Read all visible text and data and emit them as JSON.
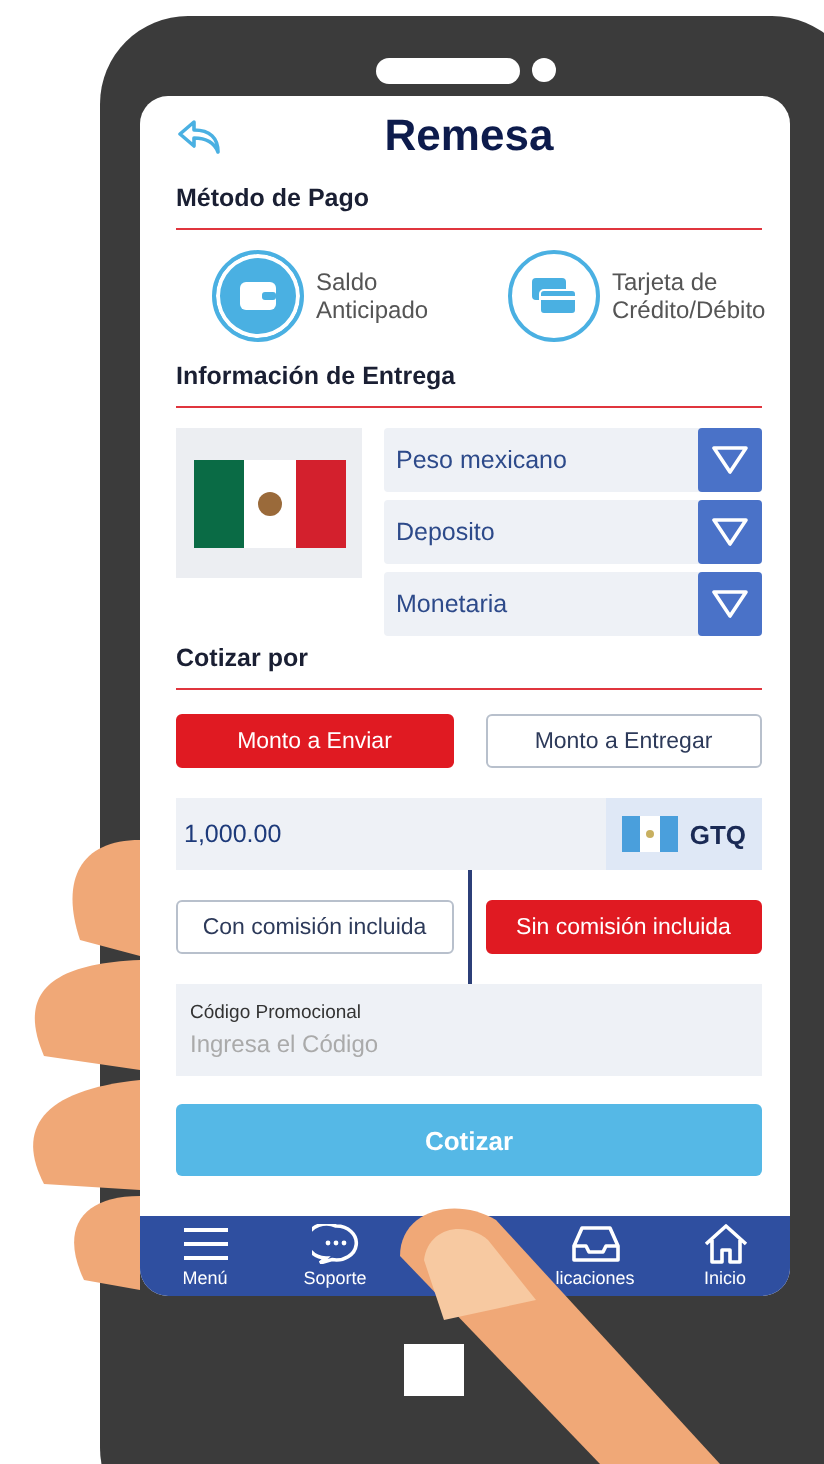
{
  "header": {
    "title": "Remesa"
  },
  "payment": {
    "label": "Método de Pago",
    "options": [
      {
        "label": "Saldo Anticipado",
        "kind": "wallet",
        "selected": true
      },
      {
        "label": "Tarjeta de Crédito/Débito",
        "kind": "card",
        "selected": false
      }
    ]
  },
  "delivery": {
    "label": "Información de Entrega",
    "selects": [
      "Peso mexicano",
      "Deposito",
      "Monetaria"
    ]
  },
  "quote": {
    "label": "Cotizar por",
    "modes": [
      {
        "label": "Monto a Enviar",
        "selected": true
      },
      {
        "label": "Monto a Entregar",
        "selected": false
      }
    ],
    "amount": {
      "value": "1,000.00",
      "currency": "GTQ"
    },
    "commission": [
      {
        "label": "Con comisión incluida",
        "selected": false
      },
      {
        "label": "Sin comisión incluida",
        "selected": true
      }
    ],
    "promo": {
      "label": "Código Promocional",
      "placeholder": "Ingresa el Código"
    },
    "submit": "Cotizar"
  },
  "nav": [
    {
      "kind": "menu",
      "label": "Menú"
    },
    {
      "kind": "chat",
      "label": "Soporte"
    },
    {
      "kind": "covered"
    },
    {
      "kind": "inbox",
      "label": "licaciones"
    },
    {
      "kind": "home",
      "label": "Inicio"
    }
  ]
}
